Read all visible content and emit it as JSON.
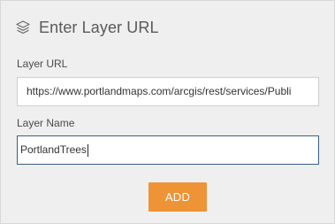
{
  "header": {
    "icon": "layers-icon",
    "title": "Enter Layer URL"
  },
  "form": {
    "url_label": "Layer URL",
    "url_value": "https://www.portlandmaps.com/arcgis/rest/services/Publi",
    "name_label": "Layer Name",
    "name_value": "PortlandTrees"
  },
  "actions": {
    "add_label": "ADD"
  },
  "colors": {
    "panel_bg": "#efefef",
    "accent_button": "#ee9436",
    "focus_border": "#3b5f8a"
  }
}
